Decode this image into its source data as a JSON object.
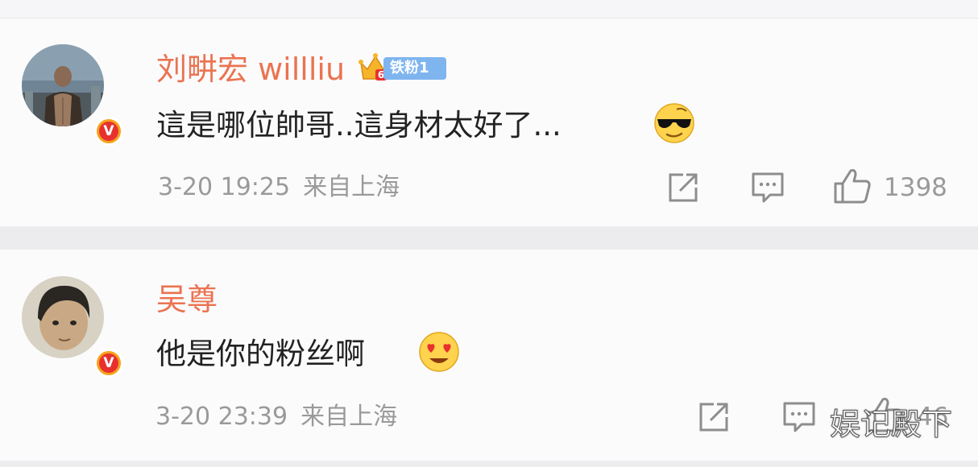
{
  "comments": [
    {
      "username": "刘畊宏 willliu",
      "fan_badge": "铁粉1",
      "fan_level": "6",
      "verified": "V",
      "text": "這是哪位帥哥..這身材太好了...",
      "emoji": "cool-sunglasses-emoji",
      "time": "3-20 19:25",
      "location": "来自上海",
      "likes": "1398"
    },
    {
      "username": "吴尊",
      "verified": "V",
      "text": "他是你的粉丝啊",
      "emoji": "heart-eyes-emoji",
      "time": "3-20 23:39",
      "location": "来自上海",
      "likes": "46"
    }
  ],
  "watermark": "娱记殿下",
  "colors": {
    "username": "#eb7350",
    "meta": "#9a9a9a",
    "badge": "#7fb5ef",
    "verified": "#e8312f"
  }
}
